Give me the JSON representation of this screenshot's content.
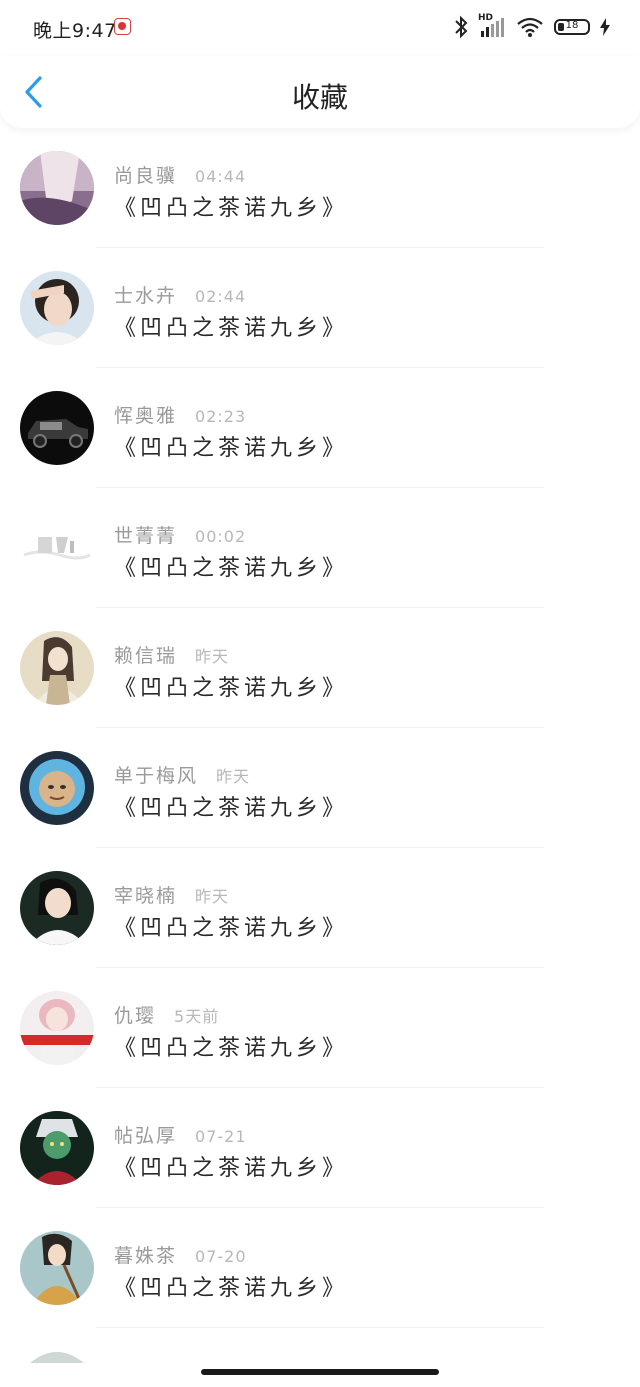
{
  "status_bar": {
    "time": "晚上9:47",
    "battery": "18",
    "network_badge": "HD",
    "icons": [
      "notification-app-icon",
      "bluetooth-icon",
      "signal-icon",
      "wifi-icon",
      "battery-icon",
      "charging-icon"
    ]
  },
  "header": {
    "title": "收藏",
    "back_icon": "chevron-left-icon"
  },
  "colors": {
    "accent": "#2b9ce8",
    "text": "#222222",
    "muted": "#9a9a9a"
  },
  "favorites": [
    {
      "name": "尚良骥",
      "time": "04:44",
      "work": "《凹凸之茶诺九乡》"
    },
    {
      "name": "士水卉",
      "time": "02:44",
      "work": "《凹凸之茶诺九乡》"
    },
    {
      "name": "恽奥雅",
      "time": "02:23",
      "work": "《凹凸之茶诺九乡》"
    },
    {
      "name": "世菁菁",
      "time": "00:02",
      "work": "《凹凸之茶诺九乡》"
    },
    {
      "name": "赖信瑞",
      "time": "昨天",
      "work": "《凹凸之茶诺九乡》"
    },
    {
      "name": "单于梅风",
      "time": "昨天",
      "work": "《凹凸之茶诺九乡》"
    },
    {
      "name": "宰晓楠",
      "time": "昨天",
      "work": "《凹凸之茶诺九乡》"
    },
    {
      "name": "仇璎",
      "time": "5天前",
      "work": "《凹凸之茶诺九乡》"
    },
    {
      "name": "帖弘厚",
      "time": "07-21",
      "work": "《凹凸之茶诺九乡》"
    },
    {
      "name": "暮姝茶",
      "time": "07-20",
      "work": "《凹凸之茶诺九乡》"
    }
  ]
}
